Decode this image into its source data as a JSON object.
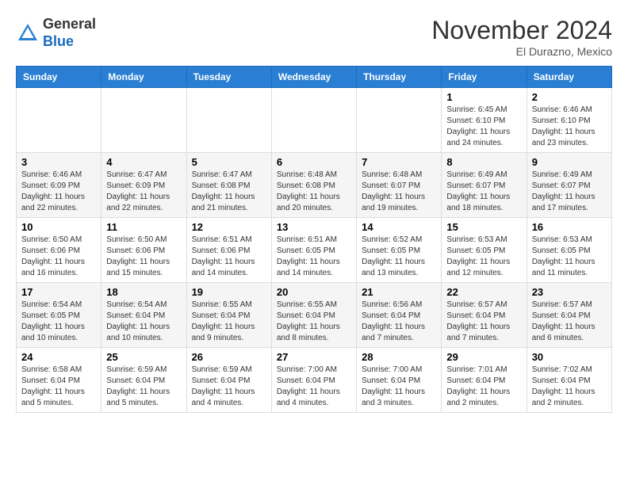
{
  "header": {
    "logo": {
      "line1": "General",
      "line2": "Blue"
    },
    "title": "November 2024",
    "location": "El Durazno, Mexico"
  },
  "days_of_week": [
    "Sunday",
    "Monday",
    "Tuesday",
    "Wednesday",
    "Thursday",
    "Friday",
    "Saturday"
  ],
  "weeks": [
    [
      {
        "day": "",
        "info": ""
      },
      {
        "day": "",
        "info": ""
      },
      {
        "day": "",
        "info": ""
      },
      {
        "day": "",
        "info": ""
      },
      {
        "day": "",
        "info": ""
      },
      {
        "day": "1",
        "info": "Sunrise: 6:45 AM\nSunset: 6:10 PM\nDaylight: 11 hours and 24 minutes."
      },
      {
        "day": "2",
        "info": "Sunrise: 6:46 AM\nSunset: 6:10 PM\nDaylight: 11 hours and 23 minutes."
      }
    ],
    [
      {
        "day": "3",
        "info": "Sunrise: 6:46 AM\nSunset: 6:09 PM\nDaylight: 11 hours and 22 minutes."
      },
      {
        "day": "4",
        "info": "Sunrise: 6:47 AM\nSunset: 6:09 PM\nDaylight: 11 hours and 22 minutes."
      },
      {
        "day": "5",
        "info": "Sunrise: 6:47 AM\nSunset: 6:08 PM\nDaylight: 11 hours and 21 minutes."
      },
      {
        "day": "6",
        "info": "Sunrise: 6:48 AM\nSunset: 6:08 PM\nDaylight: 11 hours and 20 minutes."
      },
      {
        "day": "7",
        "info": "Sunrise: 6:48 AM\nSunset: 6:07 PM\nDaylight: 11 hours and 19 minutes."
      },
      {
        "day": "8",
        "info": "Sunrise: 6:49 AM\nSunset: 6:07 PM\nDaylight: 11 hours and 18 minutes."
      },
      {
        "day": "9",
        "info": "Sunrise: 6:49 AM\nSunset: 6:07 PM\nDaylight: 11 hours and 17 minutes."
      }
    ],
    [
      {
        "day": "10",
        "info": "Sunrise: 6:50 AM\nSunset: 6:06 PM\nDaylight: 11 hours and 16 minutes."
      },
      {
        "day": "11",
        "info": "Sunrise: 6:50 AM\nSunset: 6:06 PM\nDaylight: 11 hours and 15 minutes."
      },
      {
        "day": "12",
        "info": "Sunrise: 6:51 AM\nSunset: 6:06 PM\nDaylight: 11 hours and 14 minutes."
      },
      {
        "day": "13",
        "info": "Sunrise: 6:51 AM\nSunset: 6:05 PM\nDaylight: 11 hours and 14 minutes."
      },
      {
        "day": "14",
        "info": "Sunrise: 6:52 AM\nSunset: 6:05 PM\nDaylight: 11 hours and 13 minutes."
      },
      {
        "day": "15",
        "info": "Sunrise: 6:53 AM\nSunset: 6:05 PM\nDaylight: 11 hours and 12 minutes."
      },
      {
        "day": "16",
        "info": "Sunrise: 6:53 AM\nSunset: 6:05 PM\nDaylight: 11 hours and 11 minutes."
      }
    ],
    [
      {
        "day": "17",
        "info": "Sunrise: 6:54 AM\nSunset: 6:05 PM\nDaylight: 11 hours and 10 minutes."
      },
      {
        "day": "18",
        "info": "Sunrise: 6:54 AM\nSunset: 6:04 PM\nDaylight: 11 hours and 10 minutes."
      },
      {
        "day": "19",
        "info": "Sunrise: 6:55 AM\nSunset: 6:04 PM\nDaylight: 11 hours and 9 minutes."
      },
      {
        "day": "20",
        "info": "Sunrise: 6:55 AM\nSunset: 6:04 PM\nDaylight: 11 hours and 8 minutes."
      },
      {
        "day": "21",
        "info": "Sunrise: 6:56 AM\nSunset: 6:04 PM\nDaylight: 11 hours and 7 minutes."
      },
      {
        "day": "22",
        "info": "Sunrise: 6:57 AM\nSunset: 6:04 PM\nDaylight: 11 hours and 7 minutes."
      },
      {
        "day": "23",
        "info": "Sunrise: 6:57 AM\nSunset: 6:04 PM\nDaylight: 11 hours and 6 minutes."
      }
    ],
    [
      {
        "day": "24",
        "info": "Sunrise: 6:58 AM\nSunset: 6:04 PM\nDaylight: 11 hours and 5 minutes."
      },
      {
        "day": "25",
        "info": "Sunrise: 6:59 AM\nSunset: 6:04 PM\nDaylight: 11 hours and 5 minutes."
      },
      {
        "day": "26",
        "info": "Sunrise: 6:59 AM\nSunset: 6:04 PM\nDaylight: 11 hours and 4 minutes."
      },
      {
        "day": "27",
        "info": "Sunrise: 7:00 AM\nSunset: 6:04 PM\nDaylight: 11 hours and 4 minutes."
      },
      {
        "day": "28",
        "info": "Sunrise: 7:00 AM\nSunset: 6:04 PM\nDaylight: 11 hours and 3 minutes."
      },
      {
        "day": "29",
        "info": "Sunrise: 7:01 AM\nSunset: 6:04 PM\nDaylight: 11 hours and 2 minutes."
      },
      {
        "day": "30",
        "info": "Sunrise: 7:02 AM\nSunset: 6:04 PM\nDaylight: 11 hours and 2 minutes."
      }
    ]
  ]
}
